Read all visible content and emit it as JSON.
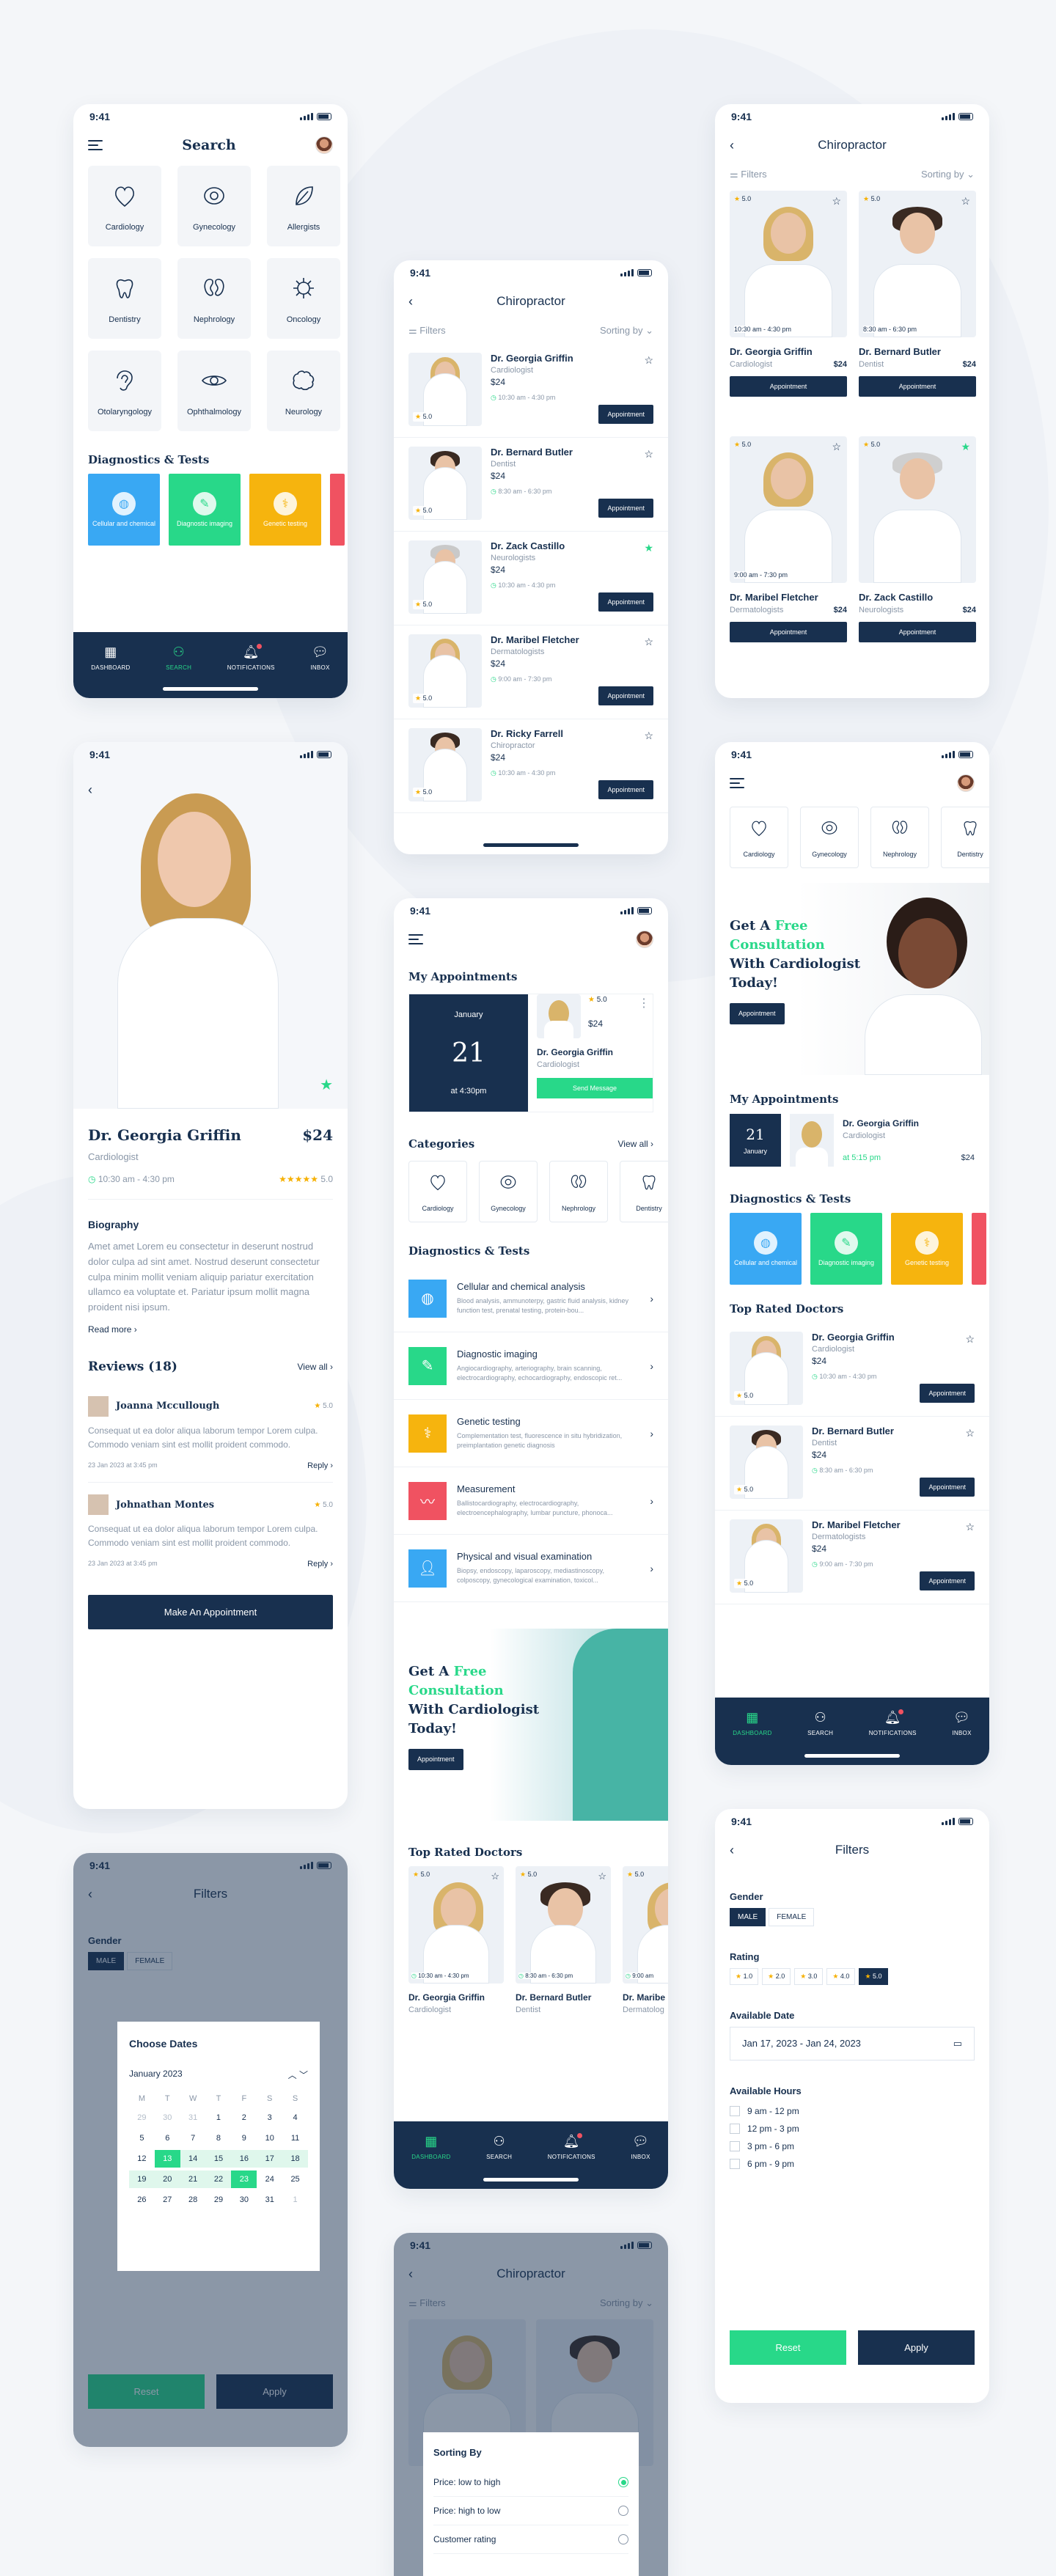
{
  "status": {
    "time": "9:41"
  },
  "search_screen": {
    "title": "Search",
    "categories": [
      "Cardiology",
      "Gynecology",
      "Allergists",
      "Dentistry",
      "Nephrology",
      "Oncology",
      "Otolaryngology",
      "Ophthalmology",
      "Neurology"
    ],
    "diagnostics_title": "Diagnostics & Tests",
    "diagnostics": [
      {
        "label": "Cellular and chemical",
        "color": "#39a8f3"
      },
      {
        "label": "Diagnostic imaging",
        "color": "#28d889"
      },
      {
        "label": "Genetic testing",
        "color": "#f6b40e"
      }
    ]
  },
  "tabs": [
    "DASHBOARD",
    "SEARCH",
    "NOTIFICATIONS",
    "INBOX"
  ],
  "chiro_list": {
    "title": "Chiropractor",
    "filters": "Filters",
    "sorting": "Sorting by",
    "doctors": [
      {
        "name": "Dr. Georgia Griffin",
        "spec": "Cardiologist",
        "price": "$24",
        "time": "10:30 am - 4:30 pm",
        "rating": "5.0"
      },
      {
        "name": "Dr. Bernard Butler",
        "spec": "Dentist",
        "price": "$24",
        "time": "8:30 am - 6:30 pm",
        "rating": "5.0"
      },
      {
        "name": "Dr. Zack Castillo",
        "spec": "Neurologists",
        "price": "$24",
        "time": "10:30 am - 4:30 pm",
        "rating": "5.0"
      },
      {
        "name": "Dr. Maribel Fletcher",
        "spec": "Dermatologists",
        "price": "$24",
        "time": "9:00 am - 7:30 pm",
        "rating": "5.0"
      },
      {
        "name": "Dr. Ricky Farrell",
        "spec": "Chiropractor",
        "price": "$24",
        "time": "10:30 am - 4:30 pm",
        "rating": "5.0"
      }
    ],
    "button": "Appointment"
  },
  "chiro_grid": {
    "title": "Chiropractor",
    "filters": "Filters",
    "sorting": "Sorting by",
    "doctors": [
      {
        "name": "Dr. Georgia Griffin",
        "spec": "Cardiologist",
        "price": "$24",
        "time": "10:30 am - 4:30 pm",
        "rating": "5.0"
      },
      {
        "name": "Dr. Bernard Butler",
        "spec": "Dentist",
        "price": "$24",
        "time": "8:30 am - 6:30 pm",
        "rating": "5.0"
      },
      {
        "name": "Dr. Maribel Fletcher",
        "spec": "Dermatologists",
        "price": "$24",
        "time": "9:00 am - 7:30 pm",
        "rating": "5.0"
      },
      {
        "name": "Dr. Zack Castillo",
        "spec": "Neurologists",
        "price": "$24",
        "time": "",
        "rating": "5.0"
      }
    ],
    "button": "Appointment"
  },
  "profile": {
    "name": "Dr. Georgia Griffin",
    "price": "$24",
    "spec": "Cardiologist",
    "hours": "10:30 am - 4:30 pm",
    "rating": "5.0",
    "bio_title": "Biography",
    "bio": "Amet amet Lorem eu consectetur in deserunt nostrud dolor culpa ad sint amet. Nostrud deserunt consectetur culpa minim mollit veniam aliquip pariatur exercitation ullamco ea voluptate et. Pariatur ipsum mollit magna proident nisi ipsum.",
    "read_more": "Read more",
    "reviews_title": "Reviews (18)",
    "view_all": "View all",
    "reviews": [
      {
        "name": "Joanna Mccullough",
        "rating": "5.0",
        "text": "Consequat ut ea dolor aliqua laborum tempor Lorem culpa. Commodo veniam sint est mollit proident commodo.",
        "date": "23 Jan 2023 at 3:45 pm",
        "reply": "Reply"
      },
      {
        "name": "Johnathan Montes",
        "rating": "5.0",
        "text": "Consequat ut ea dolor aliqua laborum tempor Lorem culpa. Commodo veniam sint est mollit proident commodo.",
        "date": "23 Jan 2023 at 3:45 pm",
        "reply": "Reply"
      }
    ],
    "cta": "Make An Appointment"
  },
  "dashboard": {
    "my_appointments": "My Appointments",
    "appt": {
      "month": "January",
      "day": "21",
      "time": "at 4:30pm",
      "doctor": "Dr. Georgia Griffin",
      "spec": "Cardiologist",
      "price": "$24",
      "rating": "5.0",
      "send": "Send Message"
    },
    "categories_title": "Categories",
    "view_all": "View all",
    "categories": [
      "Cardiology",
      "Gynecology",
      "Nephrology",
      "Dentistry"
    ],
    "diagnostics_title": "Diagnostics & Tests",
    "diagnostics": [
      {
        "title": "Cellular and chemical analysis",
        "desc": "Blood analysis, ammunoterpy, gastric fluid analysis, kidney function test, prenatal testing, protein-bou...",
        "color": "#39a8f3"
      },
      {
        "title": "Diagnostic imaging",
        "desc": "Angiocardiography, arteriography, brain scanning, electrocardiography, echocardiography, endoscopic ret...",
        "color": "#28d889"
      },
      {
        "title": "Genetic testing",
        "desc": "Complementation test, fluorescence in situ hybridization, preimplantation genetic diagnosis",
        "color": "#f6b40e"
      },
      {
        "title": "Measurement",
        "desc": "Ballistocardiography, electrocardiography, electroencephalography, lumbar puncture, phonoca...",
        "color": "#f05261"
      },
      {
        "title": "Physical and visual examination",
        "desc": "Biopsy, endoscopy, laparoscopy, mediastinoscopy, colposcopy, gynecological examination, toxicol...",
        "color": "#39a8f3"
      }
    ],
    "promo": {
      "l1": "Get A ",
      "l1b": "Free",
      "l2": "Consultation",
      "l3": "With Cardiologist",
      "l4": "Today!",
      "btn": "Appointment"
    },
    "top_rated": "Top Rated Doctors",
    "top": [
      {
        "name": "Dr. Georgia Griffin",
        "spec": "Cardiologist",
        "time": "10:30 am - 4:30 pm",
        "rating": "5.0"
      },
      {
        "name": "Dr. Bernard Butler",
        "spec": "Dentist",
        "time": "8:30 am - 6:30 pm",
        "rating": "5.0"
      },
      {
        "name": "Dr. Maribe",
        "spec": "Dermatolog",
        "time": "9:00 am",
        "rating": "5.0"
      }
    ]
  },
  "dashboard2": {
    "categories": [
      "Cardiology",
      "Gynecology",
      "Nephrology",
      "Dentistry"
    ],
    "promo": {
      "l1": "Get A ",
      "l1b": "Free",
      "l2": "Consultation",
      "l3": "With Cardiologist",
      "l4": "Today!",
      "btn": "Appointment"
    },
    "my_appointments": "My Appointments",
    "appt": {
      "day": "21",
      "month": "January",
      "doctor": "Dr. Georgia Griffin",
      "spec": "Cardiologist",
      "time": "at 5:15 pm",
      "price": "$24"
    },
    "diagnostics_title": "Diagnostics & Tests",
    "top_rated": "Top Rated Doctors",
    "doctors": [
      {
        "name": "Dr. Georgia Griffin",
        "spec": "Cardiologist",
        "price": "$24",
        "time": "10:30 am - 4:30 pm",
        "rating": "5.0"
      },
      {
        "name": "Dr. Bernard Butler",
        "spec": "Dentist",
        "price": "$24",
        "time": "8:30 am - 6:30 pm",
        "rating": "5.0"
      },
      {
        "name": "Dr. Maribel Fletcher",
        "spec": "Dermatologists",
        "price": "$24",
        "time": "9:00 am - 7:30 pm",
        "rating": "5.0"
      }
    ],
    "button": "Appointment"
  },
  "calendar": {
    "title": "Filters",
    "gender": "Gender",
    "male": "MALE",
    "female": "FEMALE",
    "popup_title": "Choose Dates",
    "month": "January 2023",
    "weekdays": [
      "M",
      "T",
      "W",
      "T",
      "F",
      "S",
      "S"
    ],
    "days": [
      "29",
      "30",
      "31",
      "1",
      "2",
      "3",
      "4",
      "5",
      "6",
      "7",
      "8",
      "9",
      "10",
      "11",
      "12",
      "13",
      "14",
      "15",
      "16",
      "17",
      "18",
      "19",
      "20",
      "21",
      "22",
      "23",
      "24",
      "25",
      "26",
      "27",
      "28",
      "29",
      "30",
      "31",
      "1"
    ],
    "reset": "Reset",
    "apply": "Apply"
  },
  "filters": {
    "title": "Filters",
    "gender": "Gender",
    "male": "MALE",
    "female": "FEMALE",
    "rating": "Rating",
    "ratings": [
      "1.0",
      "2.0",
      "3.0",
      "4.0",
      "5.0"
    ],
    "date_label": "Available Date",
    "date_value": "Jan 17, 2023 - Jan 24, 2023",
    "hours_label": "Available Hours",
    "hours": [
      "9 am - 12 pm",
      "12 pm - 3 pm",
      "3 pm - 6 pm",
      "6 pm - 9 pm"
    ],
    "reset": "Reset",
    "apply": "Apply"
  },
  "sorting": {
    "title": "Chiropractor",
    "filters": "Filters",
    "sorting": "Sorting by",
    "sheet_title": "Sorting By",
    "options": [
      "Price: low to high",
      "Price: high to low",
      "Customer rating"
    ]
  }
}
